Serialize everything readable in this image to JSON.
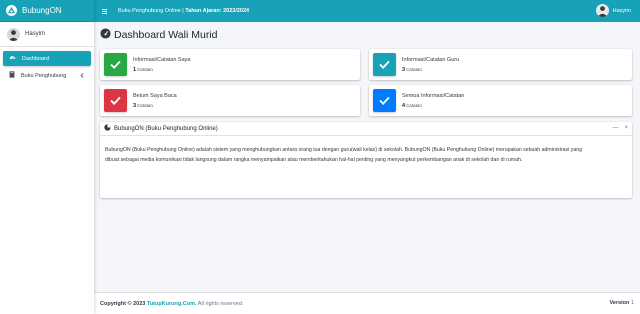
{
  "brand": {
    "name": "BubungON"
  },
  "user": {
    "name": "Hasyim"
  },
  "sidebar": {
    "items": [
      {
        "label": "Dashboard",
        "icon": "dashboard-icon",
        "active": true
      },
      {
        "label": "Buku Penghubung",
        "icon": "book-icon",
        "active": false
      }
    ]
  },
  "navbar": {
    "title_prefix": "Buku Penghubung Online | ",
    "title_year": "Tahun Ajaran: 2023/2024",
    "user_name": "Hasyim"
  },
  "page": {
    "title": "Dashboard Wali Murid"
  },
  "info_boxes": [
    {
      "label": "Informasi/Catatan Saya",
      "count": "1",
      "unit": "Catatan",
      "color": "#28a745",
      "icon": "check-icon"
    },
    {
      "label": "Informasi/Catatan Guru",
      "count": "3",
      "unit": "Catatan",
      "color": "#17a2b8",
      "icon": "check-icon"
    },
    {
      "label": "Belum Saya Baca",
      "count": "3",
      "unit": "Catatan",
      "color": "#dc3545",
      "icon": "check-icon"
    },
    {
      "label": "Semua Informasi/Catatan",
      "count": "4",
      "unit": "Catatan",
      "color": "#007bff",
      "icon": "check-icon"
    }
  ],
  "card": {
    "title": "BubungON (Buku Penghubung Online)",
    "line1": "BubungON (Buku Penghubung Online) adalah sistem yang menghubungkan antara orang tua dengan guru(wali kelas) di sekolah. BubungON (Buku Penghubung Online) merupakan sebuah administrasi yang",
    "line2": "dibuat sebagai media komunikasi tidak langsung dalam rangka menyampaikan atau memberitahukan hal-hal penting yang menyangkut perkembangan anak di sekolah dan di rumah.",
    "collapse_label": "—",
    "close_label": "×"
  },
  "footer": {
    "copyright_prefix": "Copyright © 2023 ",
    "link": "TutupKurung.Com.",
    "suffix": " All rights reserved.",
    "version_label": "Version",
    "version_number": "1"
  },
  "colors": {
    "primary": "#17a2b8",
    "success": "#28a745",
    "danger": "#dc3545",
    "blue": "#007bff",
    "background": "#f4f6f9"
  }
}
